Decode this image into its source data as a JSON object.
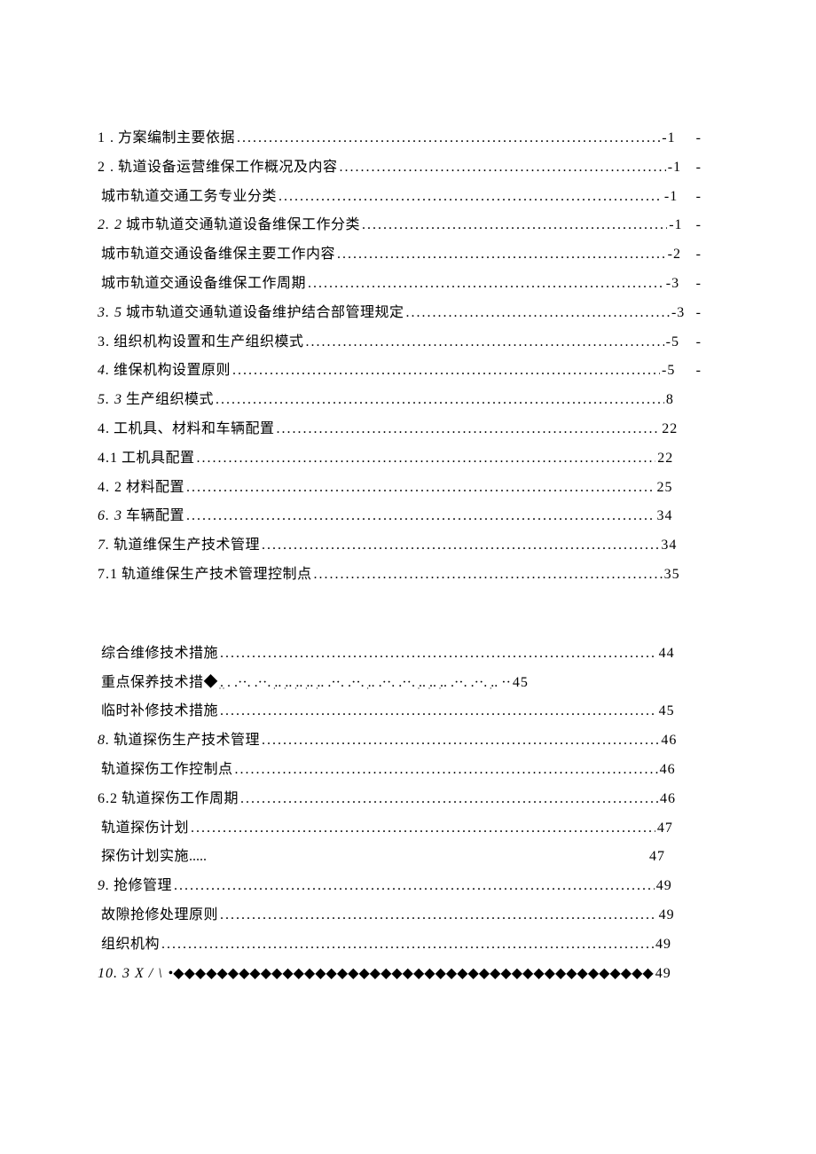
{
  "toc": [
    {
      "num": "1 .",
      "numItalic": false,
      "title": "方案编制主要依据",
      "leader": "dot",
      "page": "-1",
      "suffix": "-"
    },
    {
      "num": "2  .",
      "numItalic": false,
      "title": "轨道设备运营维保工作概况及内容 ",
      "leader": "dot",
      "page": "-1",
      "suffix": "-"
    },
    {
      "num": "",
      "numItalic": false,
      "title": "城市轨道交通工务专业分类",
      "leader": "dot",
      "page": "-1",
      "suffix": "-"
    },
    {
      "num": "2. 2",
      "numItalic": true,
      "title": "城市轨道交通轨道设备维保工作分类 ",
      "leader": "dot",
      "page": "-1",
      "suffix": "-"
    },
    {
      "num": "",
      "numItalic": false,
      "title": "城市轨道交通设备维保主要工作内容",
      "leader": "dot",
      "page": "-2",
      "suffix": "-"
    },
    {
      "num": "",
      "numItalic": false,
      "title": "城市轨道交通设备维保工作周期",
      "leader": "dot",
      "page": "-3",
      "suffix": "-"
    },
    {
      "num": "3.  5",
      "numItalic": true,
      "title": "城市轨道交通轨道设备维护结合部管理规定 ",
      "leader": "dot",
      "page": "-3",
      "suffix": "-"
    },
    {
      "num": "3.",
      "numItalic": false,
      "title": "组织机构设置和生产组织模式",
      "leader": "dot",
      "page": "-5",
      "suffix": "-"
    },
    {
      "num": "4.  ",
      "numItalic": true,
      "title": "维保机构设置原则 ",
      "leader": "dot",
      "page": "-5",
      "suffix": "-"
    },
    {
      "num": "5.  3",
      "numItalic": true,
      "title": "生产组织模式 ",
      "leader": "dot",
      "page": "8",
      "suffix": ""
    },
    {
      "num": "4.",
      "numItalic": false,
      "title": "工机具、材料和车辆配置 ",
      "leader": "dot",
      "page": "22",
      "suffix": ""
    },
    {
      "num": "4.1  ",
      "numItalic": false,
      "title": "工机具配置 ",
      "leader": "dot",
      "page": "22",
      "suffix": ""
    },
    {
      "num": "4.  2",
      "numItalic": false,
      "title": "材料配置 ",
      "leader": "dot",
      "page": "25",
      "suffix": ""
    },
    {
      "num": "6.  3",
      "numItalic": true,
      "title": "车辆配置 ",
      "leader": "dot",
      "page": "34",
      "suffix": ""
    },
    {
      "num": "7.  ",
      "numItalic": true,
      "title": "轨道维保生产技术管理 ",
      "leader": "dot",
      "page": "34",
      "suffix": ""
    },
    {
      "num": "7.1  ",
      "numItalic": false,
      "title": "轨道维保生产技术管理控制点 ",
      "leader": "dot",
      "page": "35",
      "suffix": ""
    },
    {
      "gap": true
    },
    {
      "num": "",
      "numItalic": false,
      "title": "综合维修技术措施 ",
      "leader": "dot",
      "page": "44",
      "suffix": ""
    },
    {
      "num": "",
      "numItalic": false,
      "title": "重点保养技术措◆",
      "leader": "mixed",
      "page": "45",
      "suffix": ""
    },
    {
      "num": "",
      "numItalic": false,
      "title": "临时补修技术措施 ",
      "leader": "dot",
      "page": "45",
      "suffix": ""
    },
    {
      "num": "8.  ",
      "numItalic": true,
      "title": "轨道探伤生产技术管理 ",
      "leader": "dot",
      "page": "46",
      "suffix": ""
    },
    {
      "num": "",
      "numItalic": false,
      "title": "轨道探伤工作控制点 ",
      "leader": "dot",
      "page": "46",
      "suffix": ""
    },
    {
      "num": "6.2",
      "numItalic": false,
      "title": "轨道探伤工作周期",
      "leader": "dot",
      "page": "46",
      "suffix": ""
    },
    {
      "num": "",
      "numItalic": false,
      "title": "轨道探伤计划 ",
      "leader": "dot",
      "page": "47",
      "suffix": ""
    },
    {
      "num": "",
      "numItalic": false,
      "title": "探伤计划实施",
      "leader": "shortdot",
      "page": "47",
      "suffix": ""
    },
    {
      "num": "9.  ",
      "numItalic": true,
      "title": "抢修管理 ",
      "leader": "dot",
      "page": "49",
      "suffix": ""
    },
    {
      "num": "",
      "numItalic": false,
      "title": "故隙抢修处理原则 ",
      "leader": "dot",
      "page": "49",
      "suffix": ""
    },
    {
      "num": "",
      "numItalic": false,
      "title": "组织机构 ",
      "leader": "dot",
      "page": "49",
      "suffix": ""
    },
    {
      "num": "10.      3     X / \\",
      "numItalic": true,
      "title": "",
      "leader": "diamond",
      "page": "49",
      "suffix": ""
    }
  ],
  "leaders": {
    "dot": "................................................................................................................",
    "diamond": "•◆◆◆◆◆◆◆◆◆◆◆◆◆◆◆◆◆◆◆◆◆◆◆◆◆◆◆◆◆◆◆◆◆◆◆◆◆◆◆◆◆◆◆◆◆◆◆◆◆◆◆◆◆",
    "mixed": "ִ. ִ. .··. .··. .ִ. .ִ. .ִ. .ִ. .ִ. .··. .··. .ִ. .··. .··. .ִ. .ִ. .ִ. .··. .··. .ִ. ··",
    "shortdot": "....."
  }
}
